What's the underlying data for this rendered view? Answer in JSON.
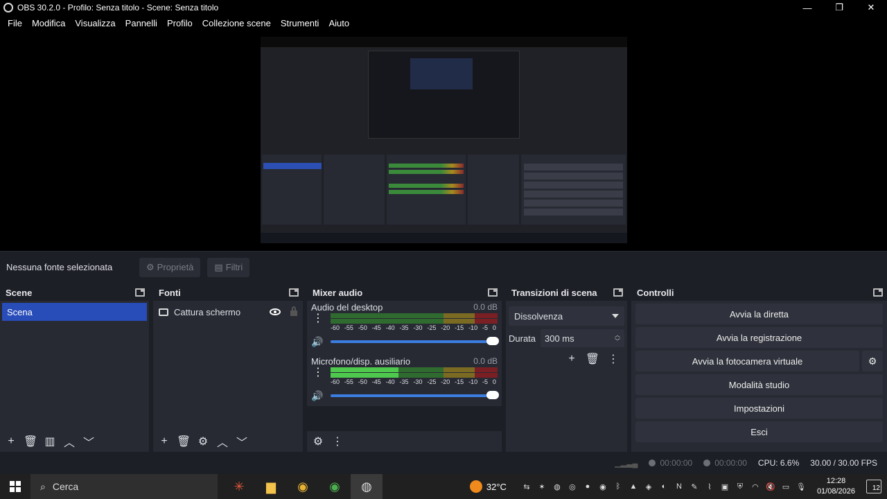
{
  "titlebar": {
    "title": "OBS 30.2.0 - Profilo: Senza titolo - Scene: Senza titolo"
  },
  "menu": [
    "File",
    "Modifica",
    "Visualizza",
    "Pannelli",
    "Profilo",
    "Collezione scene",
    "Strumenti",
    "Aiuto"
  ],
  "sourcebar": {
    "no_source": "Nessuna fonte selezionata",
    "properties": "Proprietà",
    "filters": "Filtri"
  },
  "scenes": {
    "title": "Scene",
    "items": [
      "Scena"
    ]
  },
  "sources": {
    "title": "Fonti",
    "items": [
      "Cattura schermo"
    ]
  },
  "mixer": {
    "title": "Mixer audio",
    "channels": [
      {
        "name": "Audio del desktop",
        "db": "0.0 dB"
      },
      {
        "name": "Microfono/disp. ausiliario",
        "db": "0.0 dB"
      }
    ],
    "scale": [
      "-60",
      "-55",
      "-50",
      "-45",
      "-40",
      "-35",
      "-30",
      "-25",
      "-20",
      "-15",
      "-10",
      "-5",
      "0"
    ]
  },
  "transitions": {
    "title": "Transizioni di scena",
    "selected": "Dissolvenza",
    "duration_label": "Durata",
    "duration_value": "300 ms"
  },
  "controls": {
    "title": "Controlli",
    "start_stream": "Avvia la diretta",
    "start_record": "Avvia la registrazione",
    "virtual_cam": "Avvia la fotocamera virtuale",
    "studio_mode": "Modalità studio",
    "settings": "Impostazioni",
    "exit": "Esci"
  },
  "status": {
    "stream_time": "00:00:00",
    "record_time": "00:00:00",
    "cpu": "CPU: 6.6%",
    "fps": "30.00 / 30.00 FPS"
  },
  "taskbar": {
    "search": "Cerca",
    "weather": "32°C",
    "time": "12:28",
    "date": "01/08/2026",
    "notifications": "12"
  }
}
